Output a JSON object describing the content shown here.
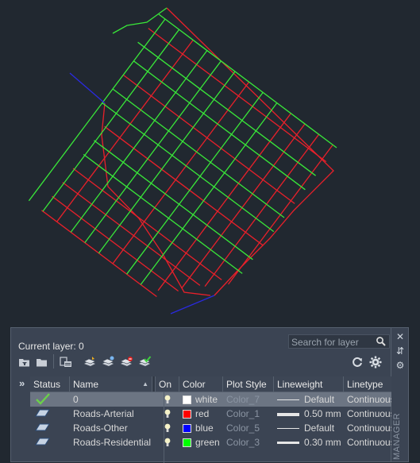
{
  "palette": {
    "current_layer_label": "Current layer: 0",
    "search_placeholder": "Search for layer",
    "side_label": "MANAGER",
    "toolbar_icons": [
      "new-property-filter-icon",
      "new-group-filter-icon",
      "layer-states-manager-icon",
      "new-layer-icon",
      "new-layer-vp-frozen-icon",
      "delete-layer-icon",
      "set-current-icon",
      "refresh-icon",
      "settings-icon"
    ]
  },
  "table": {
    "headers": {
      "status": "Status",
      "name": "Name",
      "on": "On",
      "color": "Color",
      "plot_style": "Plot Style",
      "lineweight": "Lineweight",
      "linetype": "Linetype"
    },
    "rows": [
      {
        "name": "0",
        "color": "white",
        "color_hex": "#ffffff",
        "plot_style": "Color_7",
        "lineweight": "Default",
        "linetype": "Continuous",
        "current": true
      },
      {
        "name": "Roads-Arterial",
        "color": "red",
        "color_hex": "#ff0000",
        "plot_style": "Color_1",
        "lineweight": "0.50 mm",
        "linetype": "Continuous",
        "current": false
      },
      {
        "name": "Roads-Other",
        "color": "blue",
        "color_hex": "#0000ff",
        "plot_style": "Color_5",
        "lineweight": "Default",
        "linetype": "Continuous",
        "current": false
      },
      {
        "name": "Roads-Residential",
        "color": "green",
        "color_hex": "#00ff00",
        "plot_style": "Color_3",
        "lineweight": "0.30 mm",
        "linetype": "Continuous",
        "current": false
      }
    ]
  },
  "colors": {
    "background": "#212830",
    "arterial": "#e8202a",
    "residential": "#39e639",
    "other": "#2a2ae0"
  }
}
